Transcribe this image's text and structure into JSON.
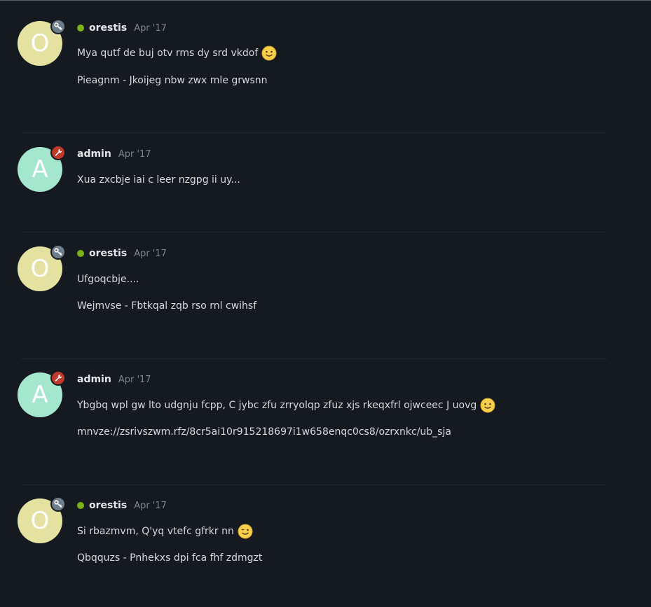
{
  "colors": {
    "background": "#151a21",
    "avatar_o": "#e5e2a1",
    "avatar_a": "#a5e6cf",
    "badge_member": "#6f7d8b",
    "badge_admin": "#c0392b",
    "online": "#7ab317"
  },
  "posts": [
    {
      "avatar_letter": "O",
      "username": "orestis",
      "online": true,
      "badge_icon": "key-icon",
      "date": "Apr '17",
      "lines": [
        {
          "text": "Mya qutf de buj otv rms dy srd vkdof",
          "emoji": "slightly-smiling-face-icon"
        },
        {
          "text": "Pieagnm - Jkoijeg nbw zwx mle grwsnn"
        }
      ]
    },
    {
      "avatar_letter": "A",
      "username": "admin",
      "online": false,
      "badge_icon": "wrench-icon",
      "date": "Apr '17",
      "lines": [
        {
          "text": "Xua zxcbje iai c leer nzgpg ii uy..."
        }
      ]
    },
    {
      "avatar_letter": "O",
      "username": "orestis",
      "online": true,
      "badge_icon": "key-icon",
      "date": "Apr '17",
      "lines": [
        {
          "text": "Ufgoqcbje...."
        },
        {
          "text": "Wejmvse - Fbtkqal zqb rso rnl cwihsf"
        }
      ]
    },
    {
      "avatar_letter": "A",
      "username": "admin",
      "online": false,
      "badge_icon": "wrench-icon",
      "date": "Apr '17",
      "lines": [
        {
          "text": "Ybgbq wpl gw lto udgnju fcpp, C jybc zfu zrryolqp zfuz xjs rkeqxfrl ojwceec J uovg",
          "emoji": "slightly-smiling-face-icon"
        },
        {
          "text": "mnvze://zsrivszwm.rfz/8cr5ai10r915218697i1w658enqc0cs8/ozrxnkc/ub_sja"
        }
      ]
    },
    {
      "avatar_letter": "O",
      "username": "orestis",
      "online": true,
      "badge_icon": "key-icon",
      "date": "Apr '17",
      "lines": [
        {
          "text": "Si rbazmvm, Q'yq vtefc gfrkr nn",
          "emoji": "winking-face-icon"
        },
        {
          "text": "Qbqquzs - Pnhekxs dpi fca fhf zdmgzt"
        }
      ]
    }
  ]
}
